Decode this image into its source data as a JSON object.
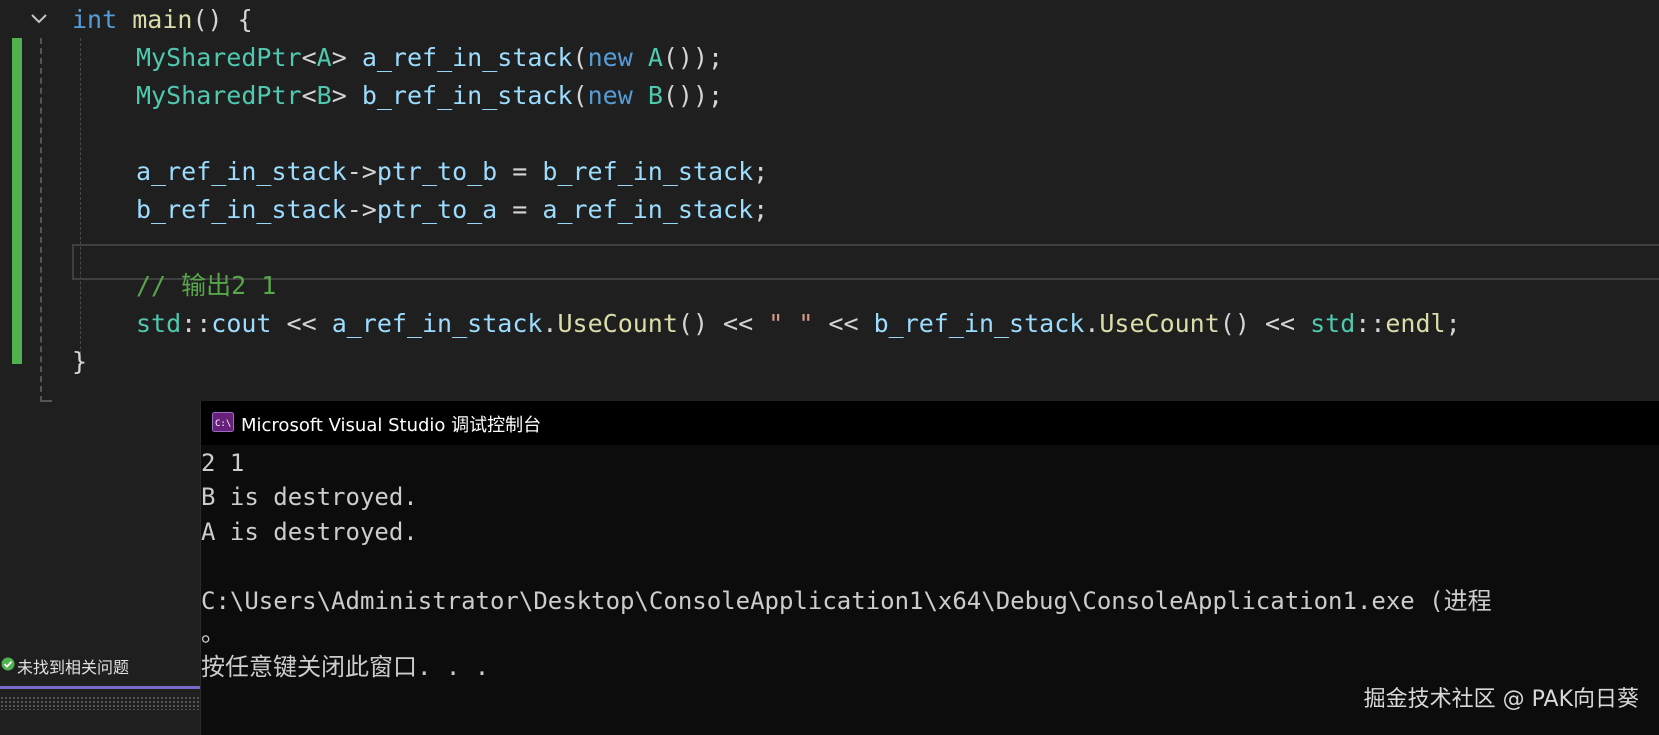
{
  "editor": {
    "lines": [
      {
        "tokens": [
          {
            "t": "int",
            "c": "kw"
          },
          {
            "t": " ",
            "c": "op"
          },
          {
            "t": "main",
            "c": "fn"
          },
          {
            "t": "() {",
            "c": "op"
          }
        ]
      },
      {
        "tokens": [
          {
            "t": "MySharedPtr",
            "c": "ty"
          },
          {
            "t": "<",
            "c": "op"
          },
          {
            "t": "A",
            "c": "ty"
          },
          {
            "t": "> ",
            "c": "op"
          },
          {
            "t": "a_ref_in_stack",
            "c": "var"
          },
          {
            "t": "(",
            "c": "op"
          },
          {
            "t": "new",
            "c": "kw"
          },
          {
            "t": " ",
            "c": "op"
          },
          {
            "t": "A",
            "c": "ty"
          },
          {
            "t": "());",
            "c": "op"
          }
        ]
      },
      {
        "tokens": [
          {
            "t": "MySharedPtr",
            "c": "ty"
          },
          {
            "t": "<",
            "c": "op"
          },
          {
            "t": "B",
            "c": "ty"
          },
          {
            "t": "> ",
            "c": "op"
          },
          {
            "t": "b_ref_in_stack",
            "c": "var"
          },
          {
            "t": "(",
            "c": "op"
          },
          {
            "t": "new",
            "c": "kw"
          },
          {
            "t": " ",
            "c": "op"
          },
          {
            "t": "B",
            "c": "ty"
          },
          {
            "t": "());",
            "c": "op"
          }
        ]
      },
      {
        "tokens": []
      },
      {
        "tokens": [
          {
            "t": "a_ref_in_stack",
            "c": "var"
          },
          {
            "t": "->",
            "c": "op"
          },
          {
            "t": "ptr_to_b",
            "c": "var"
          },
          {
            "t": " = ",
            "c": "op"
          },
          {
            "t": "b_ref_in_stack",
            "c": "var"
          },
          {
            "t": ";",
            "c": "op"
          }
        ]
      },
      {
        "tokens": [
          {
            "t": "b_ref_in_stack",
            "c": "var"
          },
          {
            "t": "->",
            "c": "op"
          },
          {
            "t": "ptr_to_a",
            "c": "var"
          },
          {
            "t": " = ",
            "c": "op"
          },
          {
            "t": "a_ref_in_stack",
            "c": "var"
          },
          {
            "t": ";",
            "c": "op"
          }
        ]
      },
      {
        "tokens": []
      },
      {
        "tokens": [
          {
            "t": "// 输出2 1",
            "c": "cm"
          }
        ]
      },
      {
        "tokens": [
          {
            "t": "std",
            "c": "ty"
          },
          {
            "t": "::",
            "c": "op"
          },
          {
            "t": "cout",
            "c": "var"
          },
          {
            "t": " << ",
            "c": "op"
          },
          {
            "t": "a_ref_in_stack",
            "c": "var"
          },
          {
            "t": ".",
            "c": "op"
          },
          {
            "t": "UseCount",
            "c": "fn"
          },
          {
            "t": "() << ",
            "c": "op"
          },
          {
            "t": "\" \"",
            "c": "str"
          },
          {
            "t": " << ",
            "c": "op"
          },
          {
            "t": "b_ref_in_stack",
            "c": "var"
          },
          {
            "t": ".",
            "c": "op"
          },
          {
            "t": "UseCount",
            "c": "fn"
          },
          {
            "t": "() << ",
            "c": "op"
          },
          {
            "t": "std",
            "c": "ty"
          },
          {
            "t": "::",
            "c": "op"
          },
          {
            "t": "endl",
            "c": "fn"
          },
          {
            "t": ";",
            "c": "op"
          }
        ]
      },
      {
        "tokens": [
          {
            "t": "}",
            "c": "op"
          }
        ]
      }
    ]
  },
  "status": {
    "label": "未找到相关问题",
    "icon": "check-circle-icon",
    "accent_color": "#7a68c9"
  },
  "console": {
    "title": "Microsoft Visual Studio 调试控制台",
    "icon": "console-app-icon",
    "output": [
      "2 1",
      "B is destroyed.",
      "A is destroyed.",
      "",
      "C:\\Users\\Administrator\\Desktop\\ConsoleApplication1\\x64\\Debug\\ConsoleApplication1.exe (进程 ",
      "。",
      "按任意键关闭此窗口. . ."
    ]
  },
  "watermark": "掘金技术社区 @ PAK向日葵",
  "colors": {
    "editor_bg": "#1f1f1f",
    "console_bg": "#0c0c0c",
    "git_added": "#4fb24f"
  }
}
